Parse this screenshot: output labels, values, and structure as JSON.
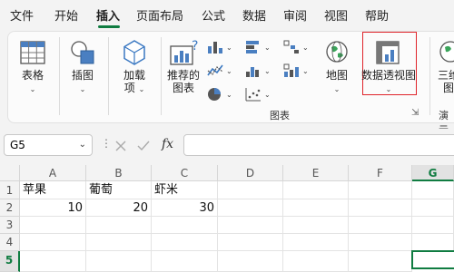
{
  "menu": {
    "items": [
      "文件",
      "开始",
      "插入",
      "页面布局",
      "公式",
      "数据",
      "审阅",
      "视图",
      "帮助"
    ],
    "active_index": 2
  },
  "ribbon": {
    "table": "表格",
    "illustrations": "插图",
    "addins_line1": "加载",
    "addins_line2": "项",
    "recommended_charts_line1": "推荐的",
    "recommended_charts_line2": "图表",
    "maps": "地图",
    "pivot_chart": "数据透视图",
    "three_d_line1": "三维",
    "three_d_line2": "图",
    "charts_group": "图表",
    "tours_group": "演示"
  },
  "formula_bar": {
    "name_box": "G5",
    "fx": "fx",
    "formula": ""
  },
  "sheet": {
    "columns": [
      "A",
      "B",
      "C",
      "D",
      "E",
      "F",
      "G"
    ],
    "rows": [
      "1",
      "2",
      "3",
      "4",
      "5"
    ],
    "cells": {
      "A1": "苹果",
      "B1": "葡萄",
      "C1": "虾米",
      "A2": "10",
      "B2": "20",
      "C2": "30"
    },
    "selected_cell": "G5"
  },
  "colors": {
    "accent": "#107c41",
    "highlight": "#e0242a"
  }
}
